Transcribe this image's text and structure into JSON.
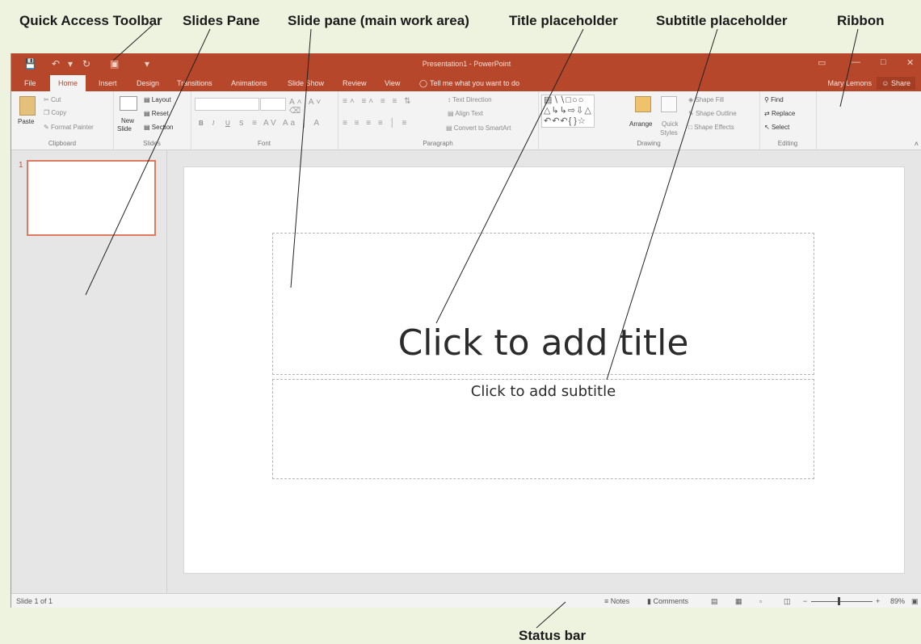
{
  "callouts": {
    "quick_access_toolbar": "Quick Access Toolbar",
    "slides_pane": "Slides Pane",
    "slide_pane": "Slide pane (main work area)",
    "title_placeholder": "Title placeholder",
    "subtitle_placeholder": "Subtitle placeholder",
    "ribbon": "Ribbon",
    "status_bar": "Status bar"
  },
  "titlebar": {
    "window_title": "Presentation1 - PowerPoint",
    "icons": [
      "save-icon",
      "undo-icon",
      "redo-icon",
      "start-from-beginning-icon",
      "customize-icon"
    ]
  },
  "tabs": [
    "File",
    "Home",
    "Insert",
    "Design",
    "Transitions",
    "Animations",
    "Slide Show",
    "Review",
    "View"
  ],
  "tell_me": "Tell me what you want to do",
  "user_name": "Mary Lemons",
  "share_label": "Share",
  "ribbon": {
    "clipboard": {
      "paste": "Paste",
      "cut": "Cut",
      "copy": "Copy",
      "format_painter": "Format Painter",
      "label": "Clipboard"
    },
    "slides": {
      "new_slide_1": "New",
      "new_slide_2": "Slide",
      "layout": "Layout",
      "reset": "Reset",
      "section": "Section",
      "label": "Slides"
    },
    "font": {
      "bold": "B",
      "italic": "I",
      "underline": "U",
      "strike": "S",
      "label": "Font"
    },
    "paragraph": {
      "text_direction": "Text Direction",
      "align_text": "Align Text",
      "convert_smartart": "Convert to SmartArt",
      "label": "Paragraph"
    },
    "drawing": {
      "arrange": "Arrange",
      "quick_1": "Quick",
      "quick_2": "Styles",
      "shape_fill": "Shape Fill",
      "shape_outline": "Shape Outline",
      "shape_effects": "Shape Effects",
      "label": "Drawing"
    },
    "editing": {
      "find": "Find",
      "replace": "Replace",
      "select": "Select",
      "label": "Editing"
    }
  },
  "slides_pane": {
    "slide_number": "1"
  },
  "slide": {
    "title_placeholder": "Click to add title",
    "subtitle_placeholder": "Click to add subtitle"
  },
  "statusbar": {
    "slide_count": "Slide 1 of 1",
    "notes": "Notes",
    "comments": "Comments",
    "zoom_out": "−",
    "zoom_in": "+",
    "zoom": "89%",
    "zoom_fraction": 0.45
  },
  "colors": {
    "accent": "#b7472a",
    "canvas_bg": "#eef3df",
    "selected_thumbnail_border": "#e07a5f"
  }
}
